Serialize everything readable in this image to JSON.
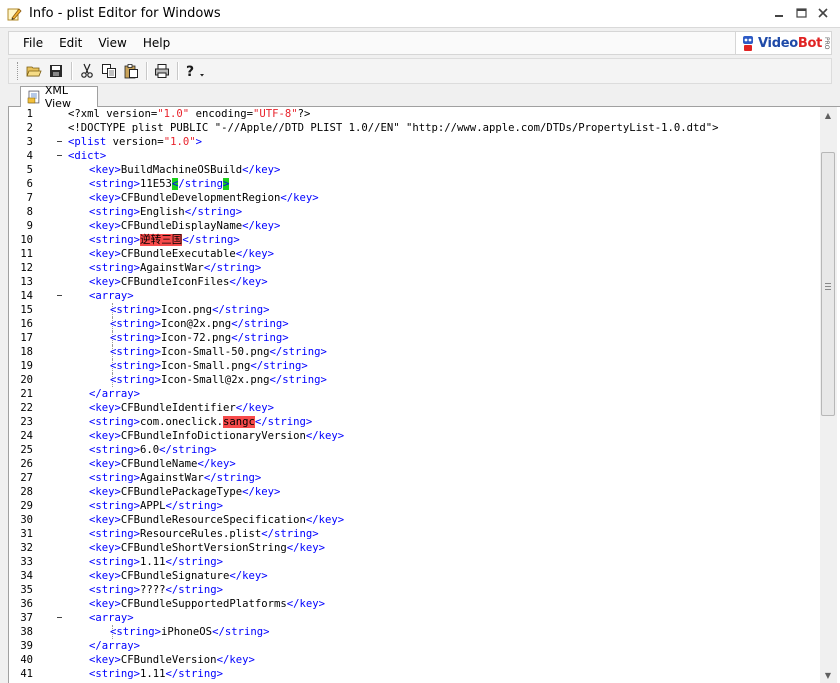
{
  "window": {
    "title": "Info - plist Editor for Windows"
  },
  "menu": {
    "items": [
      "File",
      "Edit",
      "View",
      "Help"
    ]
  },
  "logo": {
    "brand_a": "Video",
    "brand_b": "Bot",
    "badge": "PRO"
  },
  "toolbar": {
    "buttons": [
      "open-icon",
      "save-icon",
      "cut-icon",
      "copy-icon",
      "paste-icon",
      "print-icon",
      "help-icon"
    ]
  },
  "tabs": {
    "active": "XML View"
  },
  "editor": {
    "lines": [
      {
        "n": "1",
        "depth": 0,
        "fold": false,
        "segs": [
          [
            "txt",
            "<?xml version="
          ],
          [
            "str",
            "\"1.0\""
          ],
          [
            "txt",
            " encoding="
          ],
          [
            "str",
            "\"UTF-8\""
          ],
          [
            "txt",
            "?>"
          ]
        ]
      },
      {
        "n": "2",
        "depth": 0,
        "fold": false,
        "segs": [
          [
            "txt",
            "<!DOCTYPE plist PUBLIC \"-//Apple//DTD PLIST 1.0//EN\" \"http://www.apple.com/DTDs/PropertyList-1.0.dtd\">"
          ]
        ]
      },
      {
        "n": "3",
        "depth": 0,
        "fold": true,
        "segs": [
          [
            "tag",
            "<plist"
          ],
          [
            "txt",
            " version="
          ],
          [
            "str",
            "\"1.0\""
          ],
          [
            "tag",
            ">"
          ]
        ]
      },
      {
        "n": "4",
        "depth": 0,
        "fold": true,
        "segs": [
          [
            "tag",
            "<dict>"
          ]
        ]
      },
      {
        "n": "5",
        "depth": 1,
        "fold": false,
        "segs": [
          [
            "tag",
            "<key>"
          ],
          [
            "txt",
            "BuildMachineOSBuild"
          ],
          [
            "tag",
            "</key>"
          ]
        ]
      },
      {
        "n": "6",
        "depth": 1,
        "fold": false,
        "segs": [
          [
            "tag",
            "<string>"
          ],
          [
            "txt",
            "11E53"
          ],
          [
            "tag hl-green",
            "<"
          ],
          [
            "tag",
            "/string"
          ],
          [
            "tag hl-green",
            ">"
          ]
        ]
      },
      {
        "n": "7",
        "depth": 1,
        "fold": false,
        "segs": [
          [
            "tag",
            "<key>"
          ],
          [
            "txt",
            "CFBundleDevelopmentRegion"
          ],
          [
            "tag",
            "</key>"
          ]
        ]
      },
      {
        "n": "8",
        "depth": 1,
        "fold": false,
        "segs": [
          [
            "tag",
            "<string>"
          ],
          [
            "txt",
            "English"
          ],
          [
            "tag",
            "</string>"
          ]
        ]
      },
      {
        "n": "9",
        "depth": 1,
        "fold": false,
        "segs": [
          [
            "tag",
            "<key>"
          ],
          [
            "txt",
            "CFBundleDisplayName"
          ],
          [
            "tag",
            "</key>"
          ]
        ]
      },
      {
        "n": "10",
        "depth": 1,
        "fold": false,
        "segs": [
          [
            "tag",
            "<string>"
          ],
          [
            "txt hl-red",
            "逆转三国"
          ],
          [
            "tag",
            "</string>"
          ]
        ]
      },
      {
        "n": "11",
        "depth": 1,
        "fold": false,
        "segs": [
          [
            "tag",
            "<key>"
          ],
          [
            "txt",
            "CFBundleExecutable"
          ],
          [
            "tag",
            "</key>"
          ]
        ]
      },
      {
        "n": "12",
        "depth": 1,
        "fold": false,
        "segs": [
          [
            "tag",
            "<string>"
          ],
          [
            "txt",
            "AgainstWar"
          ],
          [
            "tag",
            "</string>"
          ]
        ]
      },
      {
        "n": "13",
        "depth": 1,
        "fold": false,
        "segs": [
          [
            "tag",
            "<key>"
          ],
          [
            "txt",
            "CFBundleIconFiles"
          ],
          [
            "tag",
            "</key>"
          ]
        ]
      },
      {
        "n": "14",
        "depth": 1,
        "fold": true,
        "segs": [
          [
            "tag",
            "<array>"
          ]
        ]
      },
      {
        "n": "15",
        "depth": 2,
        "fold": false,
        "segs": [
          [
            "tag",
            "<string>"
          ],
          [
            "txt",
            "Icon.png"
          ],
          [
            "tag",
            "</string>"
          ]
        ]
      },
      {
        "n": "16",
        "depth": 2,
        "fold": false,
        "segs": [
          [
            "tag",
            "<string>"
          ],
          [
            "txt",
            "Icon@2x.png"
          ],
          [
            "tag",
            "</string>"
          ]
        ]
      },
      {
        "n": "17",
        "depth": 2,
        "fold": false,
        "segs": [
          [
            "tag",
            "<string>"
          ],
          [
            "txt",
            "Icon-72.png"
          ],
          [
            "tag",
            "</string>"
          ]
        ]
      },
      {
        "n": "18",
        "depth": 2,
        "fold": false,
        "segs": [
          [
            "tag",
            "<string>"
          ],
          [
            "txt",
            "Icon-Small-50.png"
          ],
          [
            "tag",
            "</string>"
          ]
        ]
      },
      {
        "n": "19",
        "depth": 2,
        "fold": false,
        "segs": [
          [
            "tag",
            "<string>"
          ],
          [
            "txt",
            "Icon-Small.png"
          ],
          [
            "tag",
            "</string>"
          ]
        ]
      },
      {
        "n": "20",
        "depth": 2,
        "fold": false,
        "segs": [
          [
            "tag",
            "<string>"
          ],
          [
            "txt",
            "Icon-Small@2x.png"
          ],
          [
            "tag",
            "</string>"
          ]
        ]
      },
      {
        "n": "21",
        "depth": 1,
        "fold": false,
        "segs": [
          [
            "tag",
            "</array>"
          ]
        ]
      },
      {
        "n": "22",
        "depth": 1,
        "fold": false,
        "segs": [
          [
            "tag",
            "<key>"
          ],
          [
            "txt",
            "CFBundleIdentifier"
          ],
          [
            "tag",
            "</key>"
          ]
        ]
      },
      {
        "n": "23",
        "depth": 1,
        "fold": false,
        "segs": [
          [
            "tag",
            "<string>"
          ],
          [
            "txt",
            "com.oneclick."
          ],
          [
            "txt hl-red",
            "sangc"
          ],
          [
            "tag",
            "</string>"
          ]
        ]
      },
      {
        "n": "24",
        "depth": 1,
        "fold": false,
        "segs": [
          [
            "tag",
            "<key>"
          ],
          [
            "txt",
            "CFBundleInfoDictionaryVersion"
          ],
          [
            "tag",
            "</key>"
          ]
        ]
      },
      {
        "n": "25",
        "depth": 1,
        "fold": false,
        "segs": [
          [
            "tag",
            "<string>"
          ],
          [
            "txt",
            "6.0"
          ],
          [
            "tag",
            "</string>"
          ]
        ]
      },
      {
        "n": "26",
        "depth": 1,
        "fold": false,
        "segs": [
          [
            "tag",
            "<key>"
          ],
          [
            "txt",
            "CFBundleName"
          ],
          [
            "tag",
            "</key>"
          ]
        ]
      },
      {
        "n": "27",
        "depth": 1,
        "fold": false,
        "segs": [
          [
            "tag",
            "<string>"
          ],
          [
            "txt",
            "AgainstWar"
          ],
          [
            "tag",
            "</string>"
          ]
        ]
      },
      {
        "n": "28",
        "depth": 1,
        "fold": false,
        "segs": [
          [
            "tag",
            "<key>"
          ],
          [
            "txt",
            "CFBundlePackageType"
          ],
          [
            "tag",
            "</key>"
          ]
        ]
      },
      {
        "n": "29",
        "depth": 1,
        "fold": false,
        "segs": [
          [
            "tag",
            "<string>"
          ],
          [
            "txt",
            "APPL"
          ],
          [
            "tag",
            "</string>"
          ]
        ]
      },
      {
        "n": "30",
        "depth": 1,
        "fold": false,
        "segs": [
          [
            "tag",
            "<key>"
          ],
          [
            "txt",
            "CFBundleResourceSpecification"
          ],
          [
            "tag",
            "</key>"
          ]
        ]
      },
      {
        "n": "31",
        "depth": 1,
        "fold": false,
        "segs": [
          [
            "tag",
            "<string>"
          ],
          [
            "txt",
            "ResourceRules.plist"
          ],
          [
            "tag",
            "</string>"
          ]
        ]
      },
      {
        "n": "32",
        "depth": 1,
        "fold": false,
        "segs": [
          [
            "tag",
            "<key>"
          ],
          [
            "txt",
            "CFBundleShortVersionString"
          ],
          [
            "tag",
            "</key>"
          ]
        ]
      },
      {
        "n": "33",
        "depth": 1,
        "fold": false,
        "segs": [
          [
            "tag",
            "<string>"
          ],
          [
            "txt",
            "1.11"
          ],
          [
            "tag",
            "</string>"
          ]
        ]
      },
      {
        "n": "34",
        "depth": 1,
        "fold": false,
        "segs": [
          [
            "tag",
            "<key>"
          ],
          [
            "txt",
            "CFBundleSignature"
          ],
          [
            "tag",
            "</key>"
          ]
        ]
      },
      {
        "n": "35",
        "depth": 1,
        "fold": false,
        "segs": [
          [
            "tag",
            "<string>"
          ],
          [
            "txt",
            "????"
          ],
          [
            "tag",
            "</string>"
          ]
        ]
      },
      {
        "n": "36",
        "depth": 1,
        "fold": false,
        "segs": [
          [
            "tag",
            "<key>"
          ],
          [
            "txt",
            "CFBundleSupportedPlatforms"
          ],
          [
            "tag",
            "</key>"
          ]
        ]
      },
      {
        "n": "37",
        "depth": 1,
        "fold": true,
        "segs": [
          [
            "tag",
            "<array>"
          ]
        ]
      },
      {
        "n": "38",
        "depth": 2,
        "fold": false,
        "segs": [
          [
            "tag",
            "<string>"
          ],
          [
            "txt",
            "iPhoneOS"
          ],
          [
            "tag",
            "</string>"
          ]
        ]
      },
      {
        "n": "39",
        "depth": 1,
        "fold": false,
        "segs": [
          [
            "tag",
            "</array>"
          ]
        ]
      },
      {
        "n": "40",
        "depth": 1,
        "fold": false,
        "segs": [
          [
            "tag",
            "<key>"
          ],
          [
            "txt",
            "CFBundleVersion"
          ],
          [
            "tag",
            "</key>"
          ]
        ]
      },
      {
        "n": "41",
        "depth": 1,
        "fold": false,
        "segs": [
          [
            "tag",
            "<string>"
          ],
          [
            "txt",
            "1.11"
          ],
          [
            "tag",
            "</string>"
          ]
        ]
      }
    ]
  },
  "scrollbar": {
    "up_arrow": "▲",
    "down_arrow": "▼"
  }
}
